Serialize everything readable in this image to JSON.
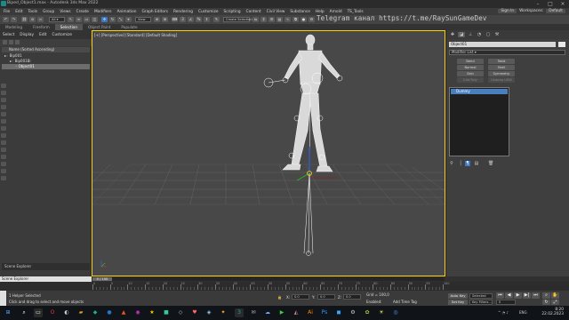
{
  "window": {
    "title": "Biped_Object1.max - Autodesk 3ds Max 2022"
  },
  "menu": {
    "items": [
      "File",
      "Edit",
      "Tools",
      "Group",
      "Views",
      "Create",
      "Modifiers",
      "Animation",
      "Graph Editors",
      "Rendering",
      "Customize",
      "Scripting",
      "Content",
      "Civil View",
      "Substance",
      "Help",
      "Arnold",
      "TS_Tools"
    ],
    "signin": "Sign In",
    "workspaces_label": "Workspaces:",
    "workspace_value": "Default"
  },
  "toolbar": {
    "view_dropdown": "View",
    "selection_set": "Create Selection Se",
    "watermark": "Telegram канал https://t.me/RaySunGameDev"
  },
  "ribbon": {
    "tabs": [
      "Modeling",
      "Freeform",
      "Selection",
      "Object Paint",
      "Populate"
    ],
    "active_index": 2
  },
  "scene_explorer": {
    "tabs": [
      "Select",
      "Display",
      "Edit",
      "Customize"
    ],
    "column_header": "Name (Sorted Ascending)",
    "items": [
      {
        "label": "Bip001"
      },
      {
        "label": "Bip001Bi"
      },
      {
        "label": "Object01"
      }
    ],
    "selected_index": 2,
    "footer_label": "Scene Explorer"
  },
  "viewport": {
    "label": "[+] [Perspective] [Standard] [Default Shading]"
  },
  "command_panel": {
    "tabs": [
      "create-icon",
      "modify-icon",
      "hierarchy-icon",
      "motion-icon",
      "display-icon",
      "utilities-icon"
    ],
    "active_tab": 1,
    "object_name": "Object01",
    "modifier_list": "Modifier List",
    "buttons": [
      {
        "label": "Bend",
        "enabled": true
      },
      {
        "label": "Twist",
        "enabled": true
      },
      {
        "label": "Normal",
        "enabled": true
      },
      {
        "label": "Shell",
        "enabled": true
      },
      {
        "label": "Skin",
        "enabled": true
      },
      {
        "label": "Symmetry",
        "enabled": true
      },
      {
        "label": "Edit Poly",
        "enabled": false
      },
      {
        "label": "Unwrap UVW",
        "enabled": false
      }
    ],
    "stack_item": "Dummy"
  },
  "timeline": {
    "explorer_field": "Scene Explorer",
    "frame_display": "0 / 100",
    "ticks": [
      "0",
      "5",
      "10",
      "15",
      "20",
      "25",
      "30",
      "35",
      "40",
      "45",
      "50",
      "55",
      "60",
      "65",
      "70",
      "75",
      "80",
      "85",
      "90",
      "95",
      "100"
    ]
  },
  "status": {
    "selection": "1 Helper Selected",
    "prompt": "Click and drag to select and move objects",
    "x_label": "X:",
    "x_value": "0.0",
    "y_label": "Y:",
    "y_value": "0.0",
    "z_label": "Z:",
    "z_value": "0.0",
    "grid_label": "Grid = 100,0",
    "enabled_label": "Enabled:",
    "add_time_tag": "Add Time Tag",
    "auto_key": "Auto Key",
    "selected_dd": "Selected",
    "set_key": "Set Key",
    "key_filters": "Key Filters...",
    "frame_field": "0"
  },
  "taskbar": {
    "time": "8:20",
    "date": "22.02.2023",
    "lang": "ENG"
  },
  "colors": {
    "viewport_border": "#ffd200",
    "selection_blue": "#4a7fbf",
    "active_tab_blue": "#3b78c8"
  }
}
